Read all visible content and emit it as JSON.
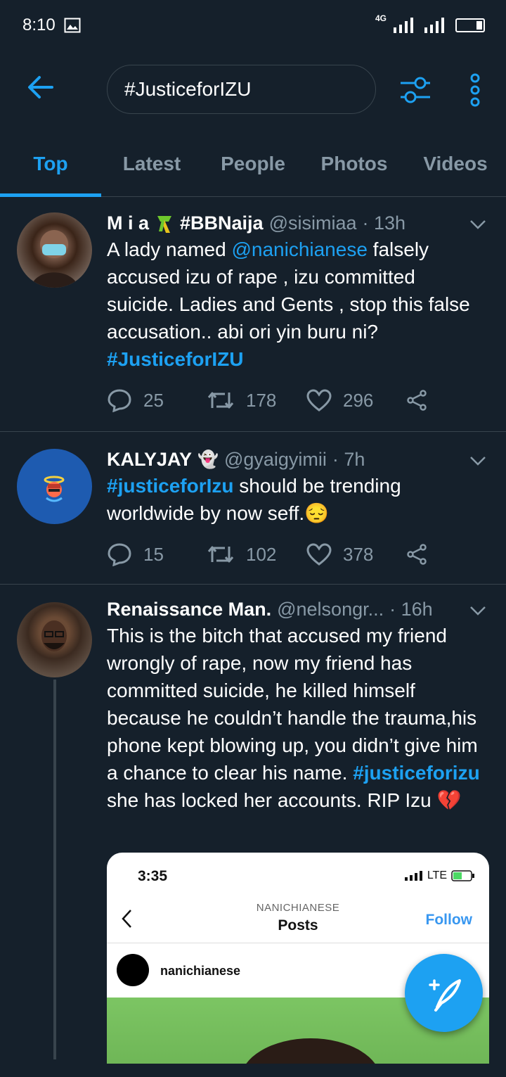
{
  "status_bar": {
    "time": "8:10",
    "network": "4G"
  },
  "search": {
    "query": "#JusticeforIZU"
  },
  "tabs": [
    "Top",
    "Latest",
    "People",
    "Photos",
    "Videos"
  ],
  "tweets": [
    {
      "name": "M i a",
      "name_suffix": "#BBNaija",
      "handle": "@sisimiaa",
      "time": "· 13h",
      "text_1": "A lady named ",
      "mention": "@nanichianese",
      "text_2": " falsely accused izu of rape , izu committed suicide. Ladies and Gents , stop this false accusation.. abi ori yin buru ni?",
      "hashtag": "#JusticeforIZU",
      "replies": "25",
      "retweets": "178",
      "likes": "296"
    },
    {
      "name": "KALYJAY",
      "emoji": "👻",
      "handle": "@gyaigyimii",
      "time": "· 7h",
      "hashtag": "#justiceforIzu",
      "text": " should be trending worldwide by now seff.",
      "emoji_end": "😔",
      "replies": "15",
      "retweets": "102",
      "likes": "378"
    },
    {
      "name": "Renaissance Man.",
      "handle": "@nelsongr...",
      "time": "· 16h",
      "text_1": "This is the bitch that accused my friend wrongly of rape, now my friend has committed suicide, he killed himself because he couldn’t handle the trauma,his phone kept blowing up, you didn’t give him a chance to clear his name. ",
      "hashtag": "#justiceforizu",
      "text_2": " she has locked her accounts. RIP Izu ",
      "emoji_end": "💔"
    }
  ],
  "embedded_screenshot": {
    "time": "3:35",
    "network": "LTE",
    "account_label": "NANICHIANESE",
    "title": "Posts",
    "follow": "Follow",
    "username": "nanichianese"
  },
  "colors": {
    "background": "#15202b",
    "accent": "#1da1f2",
    "muted": "#8899a6",
    "divider": "#38444d"
  }
}
